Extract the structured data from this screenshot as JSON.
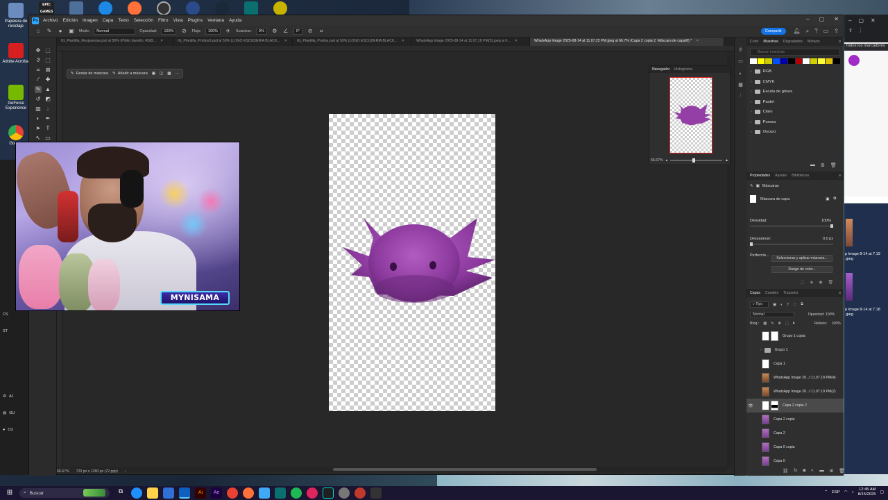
{
  "desktop": {
    "icons": [
      {
        "name": "recycle-bin",
        "label": "Papelera de reciclaje",
        "color": "#6c8cbf"
      },
      {
        "name": "adobe-acrobat",
        "label": "Adobe Acrobat",
        "color": "#d71f1f"
      },
      {
        "name": "geforce",
        "label": "GeForce Experience",
        "color": "#76b900"
      },
      {
        "name": "google-chrome",
        "label": "Google",
        "color": "#e94235"
      }
    ],
    "topbar_apps": [
      "epic-games",
      "app-2",
      "steam-app",
      "firefox",
      "obs",
      "app-grid",
      "steam",
      "app-wave",
      "app-yellow"
    ],
    "topbar_epic_label": "EPIC GAMES"
  },
  "photoshop": {
    "logo": "Ps",
    "menu": [
      "Archivo",
      "Edición",
      "Imagen",
      "Capa",
      "Texto",
      "Selección",
      "Filtro",
      "Vista",
      "Plugins",
      "Ventana",
      "Ayuda"
    ],
    "options": {
      "mode_label": "Modo:",
      "mode_value": "Normal",
      "opacity_label": "Opacidad:",
      "opacity_value": "100%",
      "flow_label": "Flujo:",
      "flow_value": "100%",
      "smooth_label": "Suavizar:",
      "smooth_value": "0%",
      "angle_value": "0°",
      "share": "Compartir"
    },
    "tabs": [
      {
        "label": "IG_Plantilla_Respuestas.psd al 50% (Pibito favorito, RGB...",
        "active": false
      },
      {
        "label": "IG_Plantilla_Podios3.psd al 50% (LOGO ESCUDERIA BLACK...",
        "active": false
      },
      {
        "label": "IG_Plantilla_Podios.psd al 50% (LOGO ESCUDERIA BLACK...",
        "active": false
      },
      {
        "label": "WhatsApp Image 2025-08-14 at 11.07.18 PM(3).jpeg al 6...",
        "active": false
      },
      {
        "label": "WhatsApp Image 2025-08-14 at 11.07.22 PM.jpeg al 66.7% (Capa 2 copia 2, Máscara de capa/8) *",
        "active": true
      }
    ],
    "context_bar": {
      "restore_mask": "Restar de máscara",
      "add_mask": "Añadir a máscara"
    },
    "status": {
      "zoom": "66.67%",
      "dimensions": "720 px x 1280 px (72 ppp)"
    },
    "navigator": {
      "tabs": [
        "Navegador",
        "Histograma"
      ],
      "zoom": "66.67%"
    },
    "swatches_panel": {
      "tabs": [
        "Color",
        "Muestras",
        "Degradados",
        "Motivos"
      ],
      "search_placeholder": "Buscar muestras",
      "swatch_colors": [
        "#ffffff",
        "#ffff00",
        "#cccc00",
        "#0050ff",
        "#0000aa",
        "#000000",
        "#b40000",
        "#ffffff",
        "#d0d000",
        "#ffff33",
        "#e0c000",
        "#000000"
      ],
      "folders": [
        "RGB",
        "CMYK",
        "Escala de grises",
        "Pastel",
        "Claro",
        "Pureza",
        "Oscuro"
      ]
    },
    "properties": {
      "tabs": [
        "Propiedades",
        "Ajustes",
        "Bibliotecas"
      ],
      "mask_type": "Máscaras",
      "layer_mask": "Máscara de capa",
      "density_label": "Densidad:",
      "density_value": "100%",
      "feather_label": "Desvanecer:",
      "feather_value": "0.0 px",
      "refine_label": "Perfeccio...",
      "select_mask_button": "Seleccionar y aplicar máscara...",
      "color_range_button": "Rango de color..."
    },
    "layers": {
      "tabs": [
        "Capas",
        "Canales",
        "Trazados"
      ],
      "filter_label": "Tipo",
      "blend_mode": "Normal",
      "opacity_label": "Opacidad:",
      "opacity_value": "100%",
      "lock_label": "Bloq.:",
      "fill_label": "Relleno:",
      "fill_value": "100%",
      "items": [
        {
          "name": "Grupo 1 copia",
          "type": "group-mask"
        },
        {
          "name": "Grupo 1",
          "type": "group"
        },
        {
          "name": "Capa 1",
          "type": "layer"
        },
        {
          "name": "WhatsApp Image 20...t 11.07.18 PM(4)",
          "type": "image"
        },
        {
          "name": "WhatsApp Image 20...t 11.07.19 PM(2)",
          "type": "image2"
        },
        {
          "name": "Capa 2 copia 2",
          "type": "mask",
          "selected": true
        },
        {
          "name": "Capa 2 copia",
          "type": "image"
        },
        {
          "name": "Capa 2",
          "type": "image"
        },
        {
          "name": "Capa 0 copia",
          "type": "image"
        },
        {
          "name": "Capa 0",
          "type": "image"
        }
      ]
    }
  },
  "webcam": {
    "name_badge": "MYNISAMA"
  },
  "side_window": {
    "bookmarks": "Todos los marcadores",
    "file1": "p Image 8-14 at 7.19 .jpeg",
    "file2": "p Image 8-14 at 7.18 .jpeg"
  },
  "left_app": {
    "items": [
      "CS",
      "ST",
      "AJ",
      "GU",
      "CU"
    ]
  },
  "taskbar": {
    "search_placeholder": "Buscar",
    "apps": [
      "#2a8a3a",
      "#1e90ff",
      "#ffd24a",
      "#2f6fd6",
      "#ffffff",
      "#0f5fc0",
      "#d7261e",
      "#8e44ad",
      "#e94235",
      "#ff7139",
      "#3fa9f5",
      "#00d084",
      "#1db954",
      "#e0245e",
      "#1f1f1f",
      "#777777",
      "#c0392b",
      "#333333"
    ],
    "lang": "ESP",
    "time": "12:45 AM",
    "date": "8/15/2025"
  }
}
